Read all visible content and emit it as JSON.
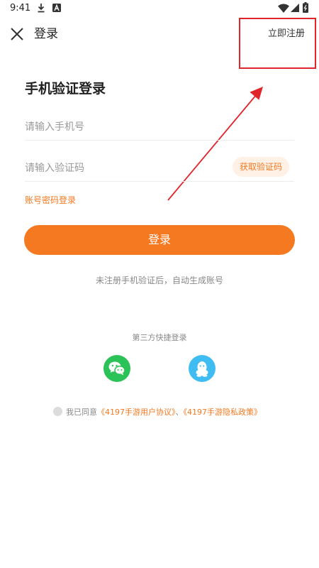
{
  "status_bar": {
    "time": "9:41",
    "icons": [
      "download-icon",
      "a-icon",
      "wifi-icon",
      "signal-icon",
      "battery-icon"
    ]
  },
  "header": {
    "close_icon": "close-icon",
    "title": "登录",
    "register_label": "立即注册"
  },
  "form": {
    "title": "手机验证登录",
    "phone_placeholder": "请输入手机号",
    "phone_value": "",
    "code_placeholder": "请输入验证码",
    "code_value": "",
    "get_code_label": "获取验证码",
    "password_login_label": "账号密码登录",
    "login_label": "登录",
    "auto_register_note": "未注册手机验证后，自动生成账号"
  },
  "third_party": {
    "title": "第三方快捷登录",
    "providers": [
      "wechat-icon",
      "qq-icon"
    ]
  },
  "agreement": {
    "prefix": "我已同意",
    "user_agreement": "《4197手游用户协议》",
    "separator": "、",
    "privacy_policy": "《4197手游隐私政策》"
  },
  "colors": {
    "accent": "#f47920",
    "annotation": "#e0262b",
    "wechat": "#2bc257",
    "qq": "#3fbdf2"
  }
}
